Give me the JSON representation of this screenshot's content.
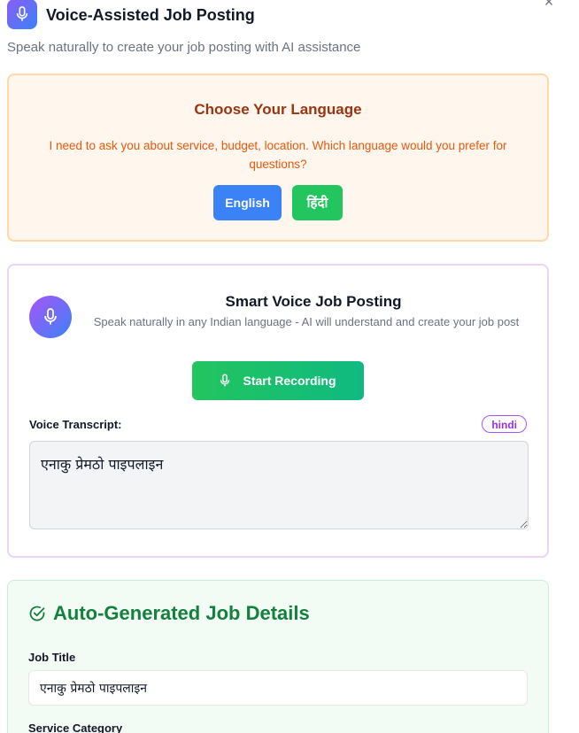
{
  "dialog": {
    "title": "Voice-Assisted Job Posting",
    "subtitle": "Speak naturally to create your job posting with AI assistance",
    "close_label": "×"
  },
  "language_prompt": {
    "title": "Choose Your Language",
    "question": "I need to ask you about service, budget, location. Which language would you prefer for questions?",
    "options": [
      "English",
      "हिंदी"
    ]
  },
  "voice": {
    "title": "Smart Voice Job Posting",
    "description": "Speak naturally in any Indian language - AI will understand and create your job post",
    "record_button": "Start Recording",
    "transcript_label": "Voice Transcript:",
    "language_badge": "hindi",
    "transcript_text": "एनाकु प्रेमठो पाइपलाइन"
  },
  "auto_generated": {
    "title": "Auto-Generated Job Details",
    "job_title_label": "Job Title",
    "job_title_value": "एनाकु प्रेमठो पाइपलाइन",
    "service_category_label": "Service Category"
  },
  "colors": {
    "english_button": "#3b82f6",
    "hindi_button": "#22c55e",
    "record_button": "#22c55e",
    "accent_purple": "#a855f7",
    "success_green": "#15803d"
  }
}
